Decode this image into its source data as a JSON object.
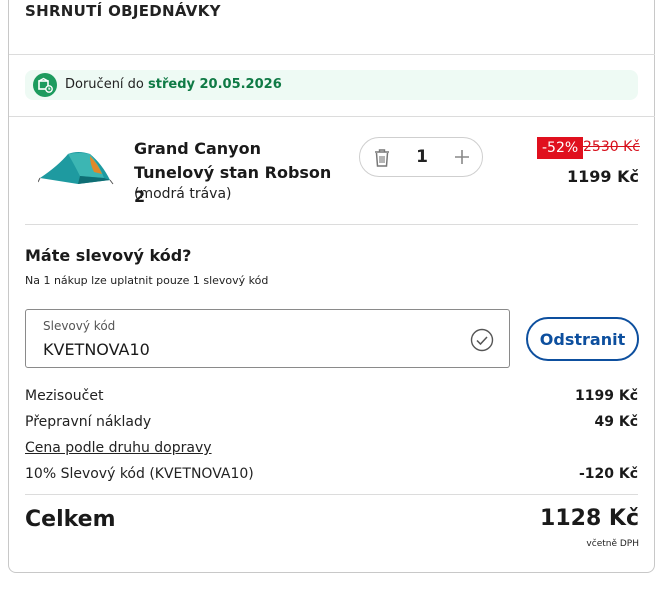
{
  "summary": {
    "title": "SHRNUTÍ OBJEDNÁVKY"
  },
  "delivery": {
    "prefix": "Doručení do ",
    "date": "středy 20.05.2026"
  },
  "product": {
    "name": "Grand Canyon Tunelový stan Robson 2",
    "variant": "(modrá tráva)",
    "quantity": "1",
    "discount": "-52%",
    "old_price": "2530 Kč",
    "price": "1199 Kč"
  },
  "coupon": {
    "question": "Máte slevový kód?",
    "note": "Na 1 nákup lze uplatnit pouze 1 slevový kód",
    "field_label": "Slevový kód",
    "field_value": "KVETNOVA10",
    "remove_label": "Odstranit"
  },
  "totals": {
    "subtotal_label": "Mezisoučet",
    "subtotal_value": "1199 Kč",
    "shipping_label": "Přepravní náklady",
    "shipping_value": "49 Kč",
    "shipping_link": "Cena podle druhu dopravy",
    "discount_label": "10% Slevový kód (KVETNOVA10)",
    "discount_value": "-120 Kč",
    "total_label": "Celkem",
    "total_value": "1128 Kč",
    "vat_note": "včetně DPH"
  },
  "colors": {
    "accent": "#0d4f9e",
    "sale_red": "#e0101e",
    "delivery_green": "#1d9b5e",
    "delivery_bg": "#eefaf4"
  },
  "icons": {
    "delivery": "delivery-box-icon",
    "trash": "trash-icon",
    "plus": "plus-icon",
    "check": "check-circle-icon"
  }
}
